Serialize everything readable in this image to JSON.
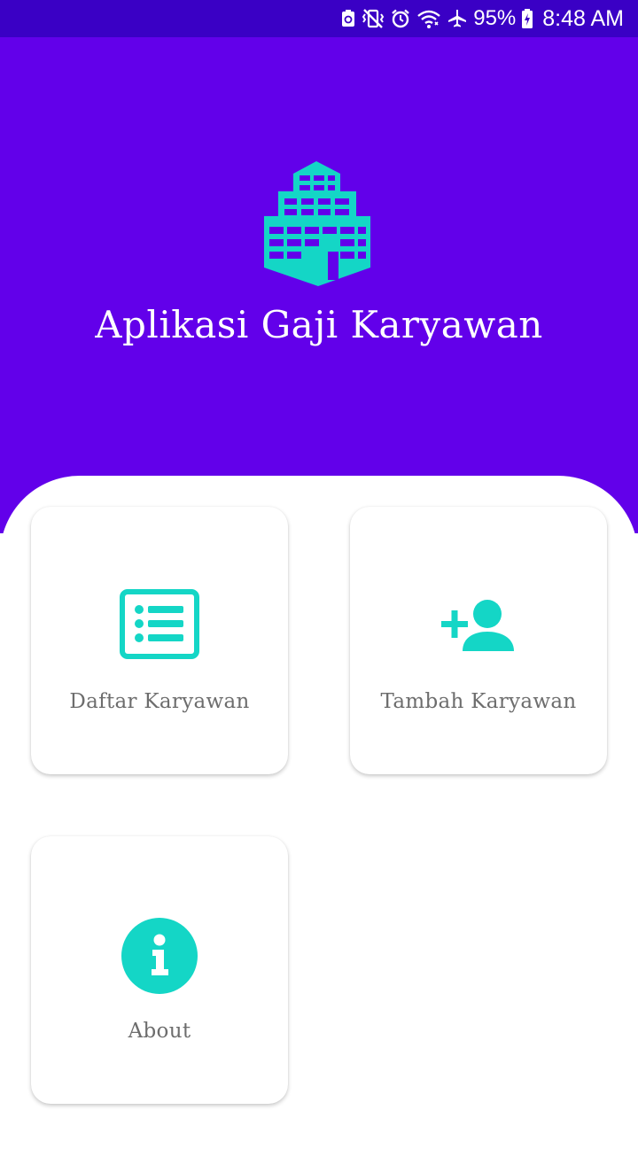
{
  "status_bar": {
    "battery": "95%",
    "time": "8:48 AM",
    "icons": [
      "recycle-battery-icon",
      "vibrate-mute-icon",
      "alarm-icon",
      "wifi-icon",
      "airplane-icon",
      "battery-charging-icon"
    ]
  },
  "header": {
    "logo_icon": "building-icon",
    "title": "Aplikasi Gaji Karyawan"
  },
  "menu": [
    {
      "label": "Daftar Karyawan",
      "icon": "list-icon"
    },
    {
      "label": "Tambah Karyawan",
      "icon": "add-person-icon"
    },
    {
      "label": "About",
      "icon": "info-icon"
    }
  ],
  "colors": {
    "status_bar": "#3a00c5",
    "primary": "#6200ea",
    "accent": "#14d6c6",
    "card_text": "#6d6d6d"
  }
}
